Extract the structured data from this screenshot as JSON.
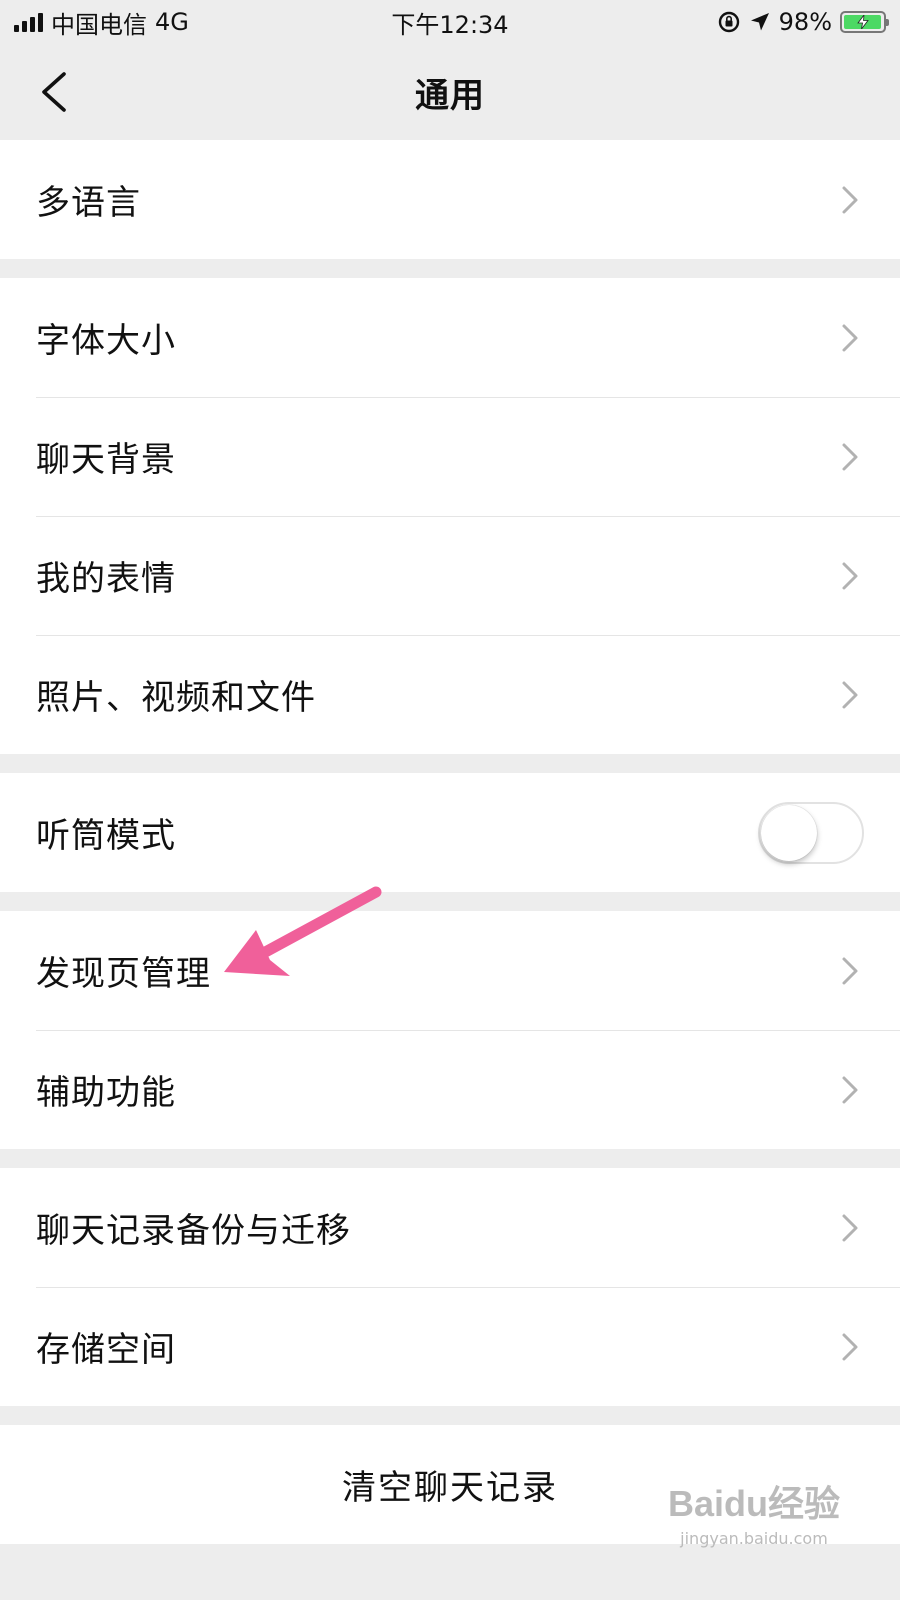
{
  "status_bar": {
    "carrier": "中国电信",
    "network": "4G",
    "time": "下午12:34",
    "battery_percent": "98%",
    "battery_level": 0.98
  },
  "nav": {
    "title": "通用",
    "back_icon": "chevron-left-icon"
  },
  "groups": [
    {
      "items": [
        {
          "label": "多语言"
        }
      ]
    },
    {
      "items": [
        {
          "label": "字体大小"
        },
        {
          "label": "聊天背景"
        },
        {
          "label": "我的表情"
        },
        {
          "label": "照片、视频和文件"
        }
      ]
    },
    {
      "items": [
        {
          "label": "听筒模式",
          "toggle": false
        }
      ]
    },
    {
      "items": [
        {
          "label": "发现页管理"
        },
        {
          "label": "辅助功能"
        }
      ]
    },
    {
      "items": [
        {
          "label": "聊天记录备份与迁移"
        },
        {
          "label": "存储空间"
        }
      ]
    }
  ],
  "clear_history": {
    "label": "清空聊天记录"
  },
  "annotation": {
    "arrow_color": "#f0609a"
  },
  "watermark": {
    "logo": "Baidu经验",
    "url": "jingyan.baidu.com"
  },
  "colors": {
    "background": "#ededed",
    "toggle_off_border": "#e2e2e2",
    "battery_fill": "#4cd964"
  }
}
